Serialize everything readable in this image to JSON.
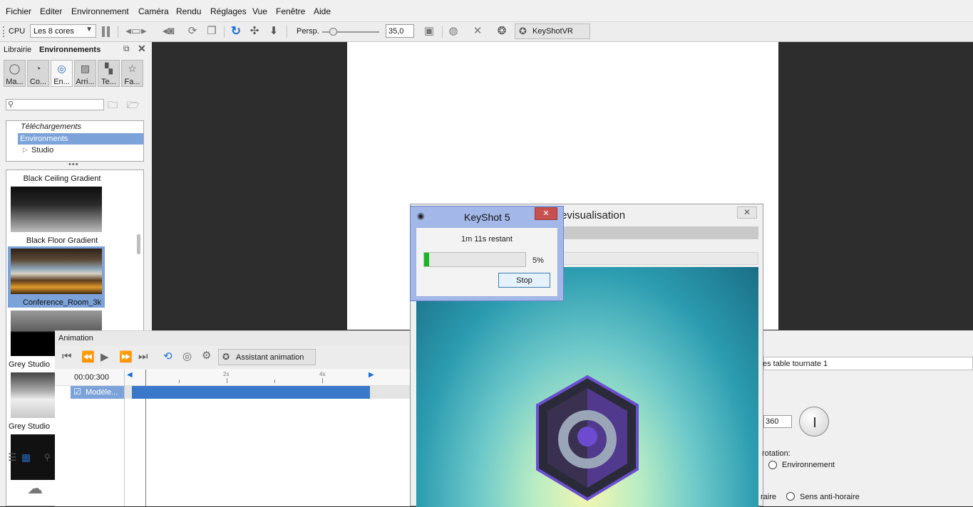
{
  "menu": [
    "Fichier",
    "Editer",
    "Environnement",
    "Caméra",
    "Rendu",
    "Réglages",
    "Vue",
    "Fenêtre",
    "Aide"
  ],
  "toolbar": {
    "cpu_label": "CPU",
    "cores_select": "Les 8 cores",
    "persp_label": "Persp.",
    "fov_value": "35,0",
    "keyshotvr_label": "KeyShotVR"
  },
  "library": {
    "label": "Librairie",
    "title": "Environnements",
    "tabs": [
      "Ma...",
      "Co...",
      "En...",
      "Arri...",
      "Te...",
      "Fa..."
    ],
    "tree": {
      "downloads": "Téléchargements",
      "environments": "Environments",
      "studio": "Studio"
    },
    "envs": [
      "Black Ceiling Gradient",
      "Black Floor Gradient",
      "Conference_Room_3k",
      "Grey Studio",
      "Grey Studio"
    ]
  },
  "animation": {
    "title": "Animation",
    "assistant_label": "Assistant animation",
    "time_display": "00:00:300",
    "ticks": [
      "2s",
      "4s"
    ],
    "track_label": "Modèle..."
  },
  "preview": {
    "title_fragment": "evisualisation"
  },
  "dialog": {
    "title": "KeyShot 5",
    "remaining": "1m 11s restant",
    "percent_text": "5%",
    "progress": 0.05,
    "stop_label": "Stop"
  },
  "right": {
    "anim_name_fragment": "es table tournate 1",
    "angle_value": "360",
    "rotation_label": "rotation:",
    "env_option": "Environnement",
    "dir_fragment": "raire",
    "dir_option": "Sens anti-horaire"
  },
  "colors": {
    "selection": "#7ba3d9",
    "track": "#3a78c9",
    "progress": "#1db526"
  }
}
